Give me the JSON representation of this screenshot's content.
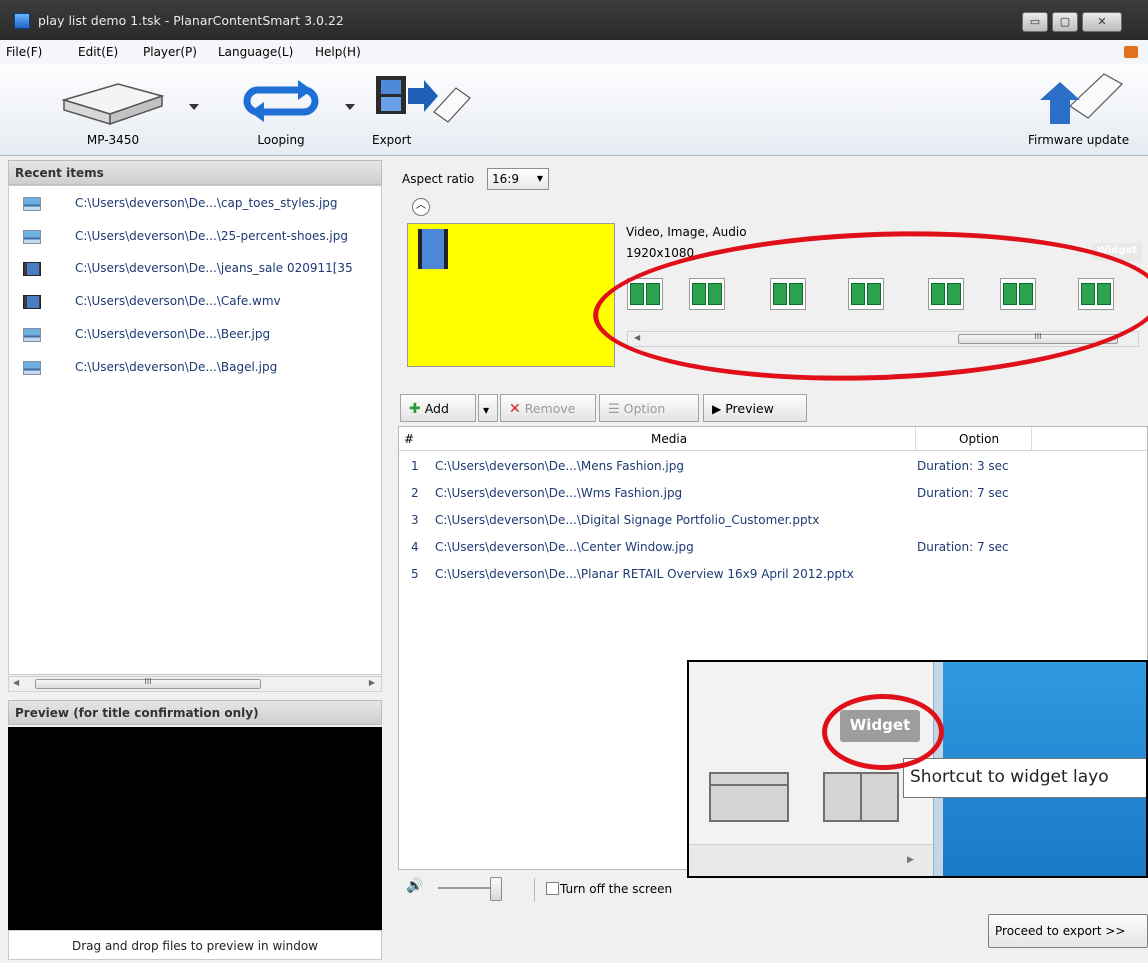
{
  "window": {
    "title": "play list demo 1.tsk - PlanarContentSmart 3.0.22",
    "controls": {
      "minimize": "▭",
      "maximize": "▢",
      "close": "✕"
    }
  },
  "menu": [
    "File(F)",
    "Edit(E)",
    "Player(P)",
    "Language(L)",
    "Help(H)"
  ],
  "toolbar": {
    "player": "MP-3450",
    "looping": "Looping",
    "export": "Export",
    "firmware": "Firmware update"
  },
  "recent": {
    "title": "Recent items",
    "items": [
      {
        "path": "C:\\Users\\deverson\\De...\\cap_toes_styles.jpg",
        "icon": "image-file-icon"
      },
      {
        "path": "C:\\Users\\deverson\\De...\\25-percent-shoes.jpg",
        "icon": "image-file-icon"
      },
      {
        "path": "C:\\Users\\deverson\\De...\\jeans_sale 020911[35",
        "icon": "video-file-icon"
      },
      {
        "path": "C:\\Users\\deverson\\De...\\Cafe.wmv",
        "icon": "video-file-icon"
      },
      {
        "path": "C:\\Users\\deverson\\De...\\Beer.jpg",
        "icon": "image-file-icon"
      },
      {
        "path": "C:\\Users\\deverson\\De...\\Bagel.jpg",
        "icon": "image-file-icon"
      }
    ]
  },
  "preview": {
    "title": "Preview (for title confirmation only)",
    "hint": "Drag and drop files to preview in window"
  },
  "layout": {
    "aspect_label": "Aspect ratio",
    "aspect_value": "16:9",
    "desc_line1": "Video, Image, Audio",
    "desc_line2": "1920x1080",
    "widget_label": "Widget"
  },
  "media_toolbar": {
    "add": "Add",
    "remove": "Remove",
    "option": "Option",
    "preview": "Preview"
  },
  "media": {
    "columns": [
      "#",
      "Media",
      "Option"
    ],
    "rows": [
      {
        "n": "1",
        "media": "C:\\Users\\deverson\\De...\\Mens Fashion.jpg",
        "option": "Duration: 3 sec"
      },
      {
        "n": "2",
        "media": "C:\\Users\\deverson\\De...\\Wms Fashion.jpg",
        "option": "Duration: 7 sec"
      },
      {
        "n": "3",
        "media": "C:\\Users\\deverson\\De...\\Digital Signage Portfolio_Customer.pptx",
        "option": ""
      },
      {
        "n": "4",
        "media": "C:\\Users\\deverson\\De...\\Center Window.jpg",
        "option": "Duration: 7 sec"
      },
      {
        "n": "5",
        "media": "C:\\Users\\deverson\\De...\\Planar RETAIL Overview 16x9 April 2012.pptx",
        "option": ""
      }
    ]
  },
  "bottom": {
    "volume_icon": "speaker-icon",
    "screen_off": "Turn off the screen",
    "proceed": "Proceed to export >>"
  },
  "inset": {
    "widget": "Widget",
    "tooltip": "Shortcut to widget layo"
  },
  "colors": {
    "annotation": "#e0101a",
    "layout_bg": "#ffff00"
  }
}
